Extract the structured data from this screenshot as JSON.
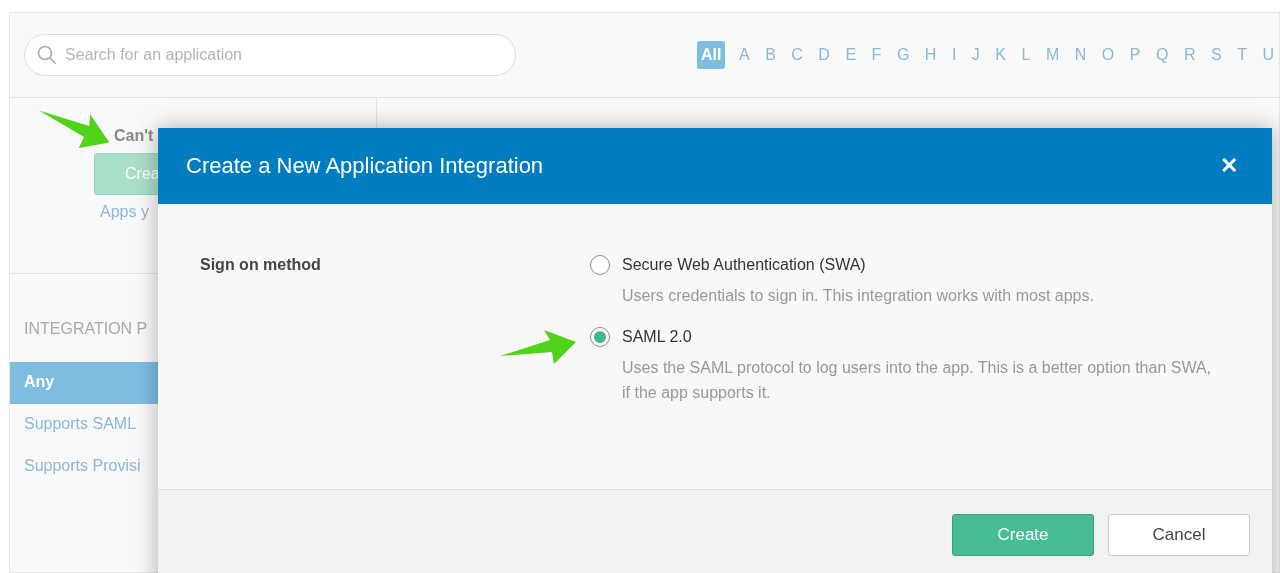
{
  "search": {
    "placeholder": "Search for an application"
  },
  "letters": [
    {
      "label": "All",
      "selected": true
    },
    {
      "label": "A",
      "selected": false
    },
    {
      "label": "B",
      "selected": false
    },
    {
      "label": "C",
      "selected": false
    },
    {
      "label": "D",
      "selected": false
    },
    {
      "label": "E",
      "selected": false
    },
    {
      "label": "F",
      "selected": false
    },
    {
      "label": "G",
      "selected": false
    },
    {
      "label": "H",
      "selected": false
    },
    {
      "label": "I",
      "selected": false
    },
    {
      "label": "J",
      "selected": false
    },
    {
      "label": "K",
      "selected": false
    },
    {
      "label": "L",
      "selected": false
    },
    {
      "label": "M",
      "selected": false
    },
    {
      "label": "N",
      "selected": false
    },
    {
      "label": "O",
      "selected": false
    },
    {
      "label": "P",
      "selected": false
    },
    {
      "label": "Q",
      "selected": false
    },
    {
      "label": "R",
      "selected": false
    },
    {
      "label": "S",
      "selected": false
    },
    {
      "label": "T",
      "selected": false
    },
    {
      "label": "U",
      "selected": false
    }
  ],
  "sidebar": {
    "prompt": "Can't",
    "button": "Crea",
    "link": "Apps y",
    "section_title": "INTEGRATION P",
    "filters": [
      {
        "label": "Any",
        "selected": true
      },
      {
        "label": "Supports SAML",
        "selected": false
      },
      {
        "label": "Supports Provisi",
        "selected": false
      }
    ]
  },
  "dialog": {
    "title": "Create a New Application Integration",
    "close": "✕",
    "field_label": "Sign on method",
    "options": [
      {
        "label": "Secure Web Authentication (SWA)",
        "description": "Users credentials to sign in. This integration works with most apps.",
        "selected": false
      },
      {
        "label": "SAML 2.0",
        "description": "Uses the SAML protocol to log users into the app. This is a better option than SWA, if the app supports it.",
        "selected": true
      }
    ],
    "buttons": [
      {
        "label": "Create",
        "kind": "primary"
      },
      {
        "label": "Cancel",
        "kind": "secondary"
      }
    ]
  }
}
